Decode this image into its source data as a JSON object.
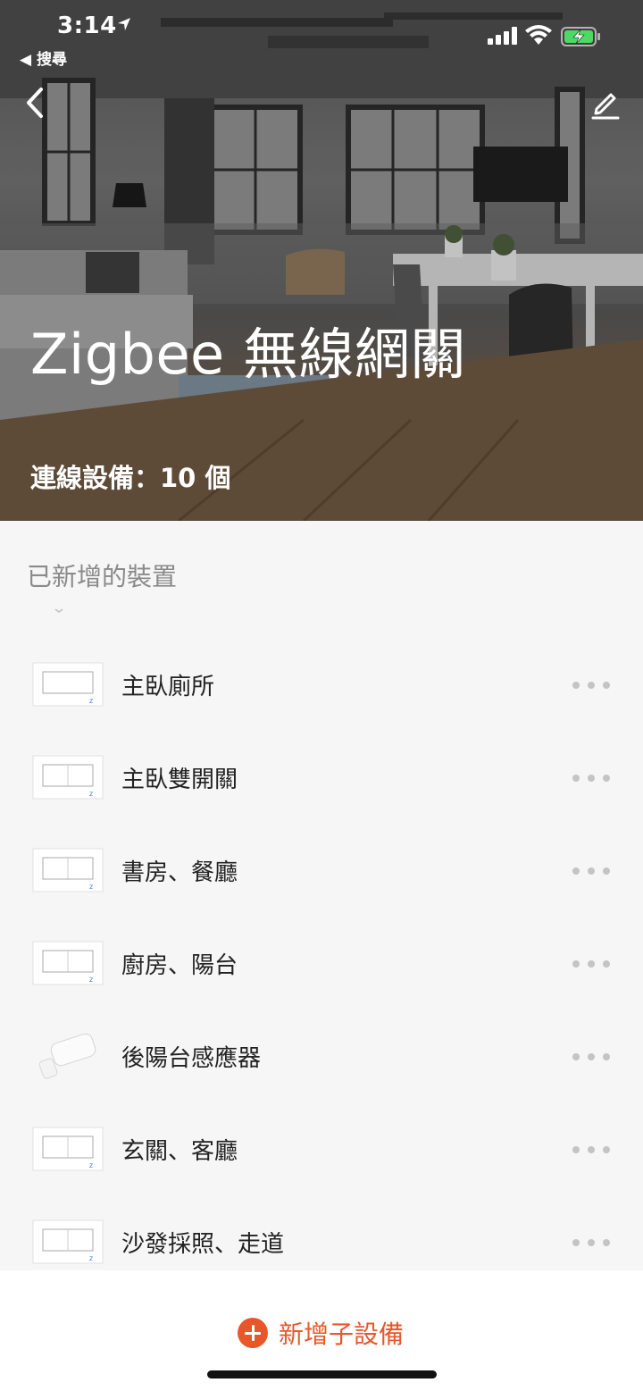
{
  "status_bar": {
    "time": "3:14",
    "back_app_label": "◀ 搜尋"
  },
  "header": {
    "title": "Zigbee 無線網關",
    "subtitle": "連線設備：10 個"
  },
  "section": {
    "title": "已新增的裝置"
  },
  "devices": [
    {
      "label": "主臥廁所",
      "icon": "switch-panel-icon"
    },
    {
      "label": "主臥雙開關",
      "icon": "switch-panel-icon"
    },
    {
      "label": "書房、餐廳",
      "icon": "switch-panel-icon"
    },
    {
      "label": "廚房、陽台",
      "icon": "switch-panel-icon"
    },
    {
      "label": "後陽台感應器",
      "icon": "door-sensor-icon"
    },
    {
      "label": "玄關、客廳",
      "icon": "switch-panel-icon"
    },
    {
      "label": "沙發採照、走道",
      "icon": "switch-panel-icon"
    }
  ],
  "footer": {
    "add_label": "新增子設備"
  },
  "colors": {
    "accent": "#e8572a",
    "battery": "#4cd964"
  }
}
